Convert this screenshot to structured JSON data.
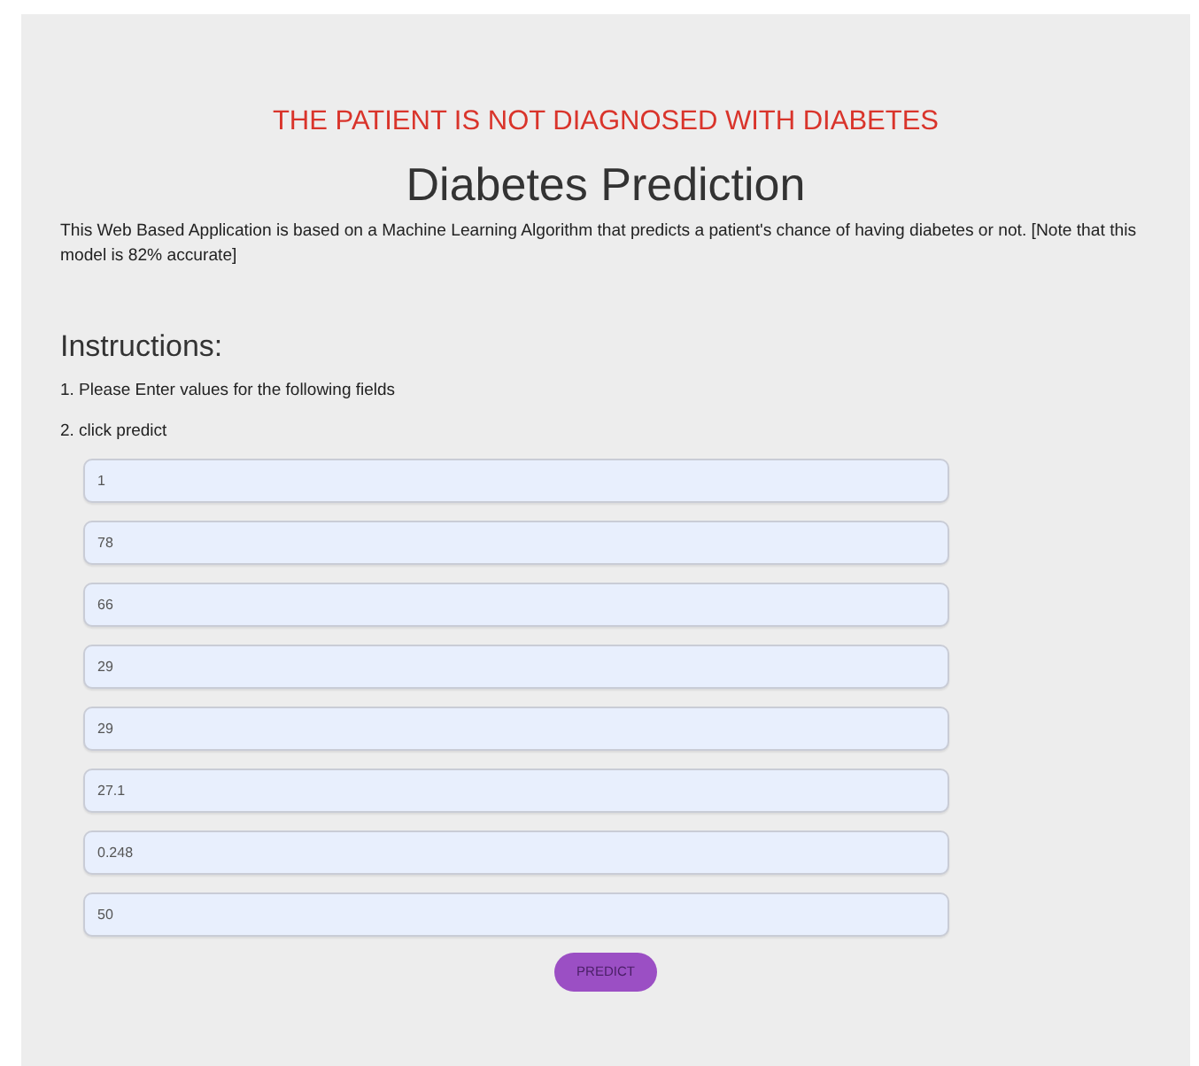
{
  "result": "THE PATIENT IS NOT DIAGNOSED WITH DIABETES",
  "title": "Diabetes Prediction",
  "description": "This Web Based Application is based on a Machine Learning Algorithm that predicts a patient's chance of having diabetes or not. [Note that this model is 82% accurate]",
  "instructions": {
    "heading": "Instructions:",
    "steps": [
      "1. Please Enter values for the following fields",
      "2. click predict"
    ]
  },
  "fields": [
    {
      "value": "1"
    },
    {
      "value": "78"
    },
    {
      "value": "66"
    },
    {
      "value": "29"
    },
    {
      "value": "29"
    },
    {
      "value": "27.1"
    },
    {
      "value": "0.248"
    },
    {
      "value": "50"
    }
  ],
  "button": "PREDICT"
}
